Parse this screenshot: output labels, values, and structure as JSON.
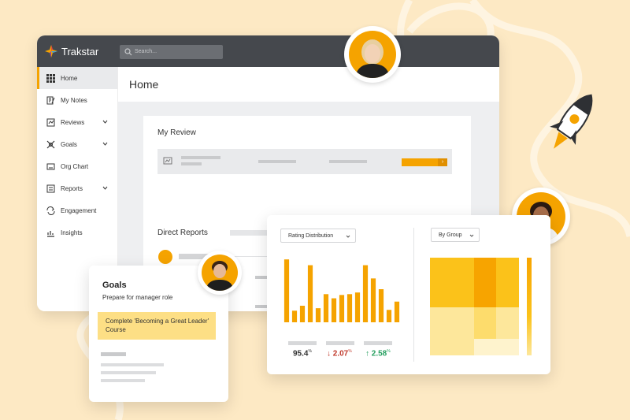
{
  "app": {
    "brand": "Trakstar",
    "search_placeholder": "Search..."
  },
  "sidebar": {
    "items": [
      {
        "label": "Home",
        "icon": "grid-icon",
        "active": true,
        "has_chevron": false
      },
      {
        "label": "My Notes",
        "icon": "notes-icon",
        "active": false,
        "has_chevron": false
      },
      {
        "label": "Reviews",
        "icon": "reviews-icon",
        "active": false,
        "has_chevron": true
      },
      {
        "label": "Goals",
        "icon": "goals-icon",
        "active": false,
        "has_chevron": true
      },
      {
        "label": "Org Chart",
        "icon": "org-chart-icon",
        "active": false,
        "has_chevron": false
      },
      {
        "label": "Reports",
        "icon": "reports-icon",
        "active": false,
        "has_chevron": true
      },
      {
        "label": "Engagement",
        "icon": "engagement-icon",
        "active": false,
        "has_chevron": false
      },
      {
        "label": "Insights",
        "icon": "insights-icon",
        "active": false,
        "has_chevron": false
      }
    ]
  },
  "main": {
    "title": "Home",
    "my_review_title": "My Review",
    "direct_reports_title": "Direct Reports",
    "action_arrow": "›"
  },
  "analytics": {
    "rating_dropdown": "Rating Distribution",
    "group_dropdown": "By Group",
    "stats": [
      {
        "value": "95.4",
        "unit": "%",
        "trend": "none",
        "color": "#333333"
      },
      {
        "value": "2.07",
        "unit": "%",
        "trend": "down",
        "arrow": "↓",
        "color": "#c0392b"
      },
      {
        "value": "2.58",
        "unit": "%",
        "trend": "up",
        "arrow": "↑",
        "color": "#27a060"
      }
    ]
  },
  "chart_data": {
    "type": "bar",
    "values": [
      7.6,
      1.4,
      2.0,
      6.9,
      1.7,
      3.4,
      2.9,
      3.3,
      3.4,
      3.6,
      6.9,
      5.3,
      4.0,
      1.5,
      2.5
    ]
  },
  "heatmap_colors": [
    "#fbc21a",
    "#f7a400",
    "#fddc6c",
    "#fde79b",
    "#fef3cd"
  ],
  "goals": {
    "title": "Goals",
    "subtitle": "Prepare for manager role",
    "task": "Complete 'Becoming a Great Leader' Course"
  },
  "colors": {
    "accent": "#f5a300",
    "topbar": "#45484d",
    "background": "#fde9c4"
  }
}
